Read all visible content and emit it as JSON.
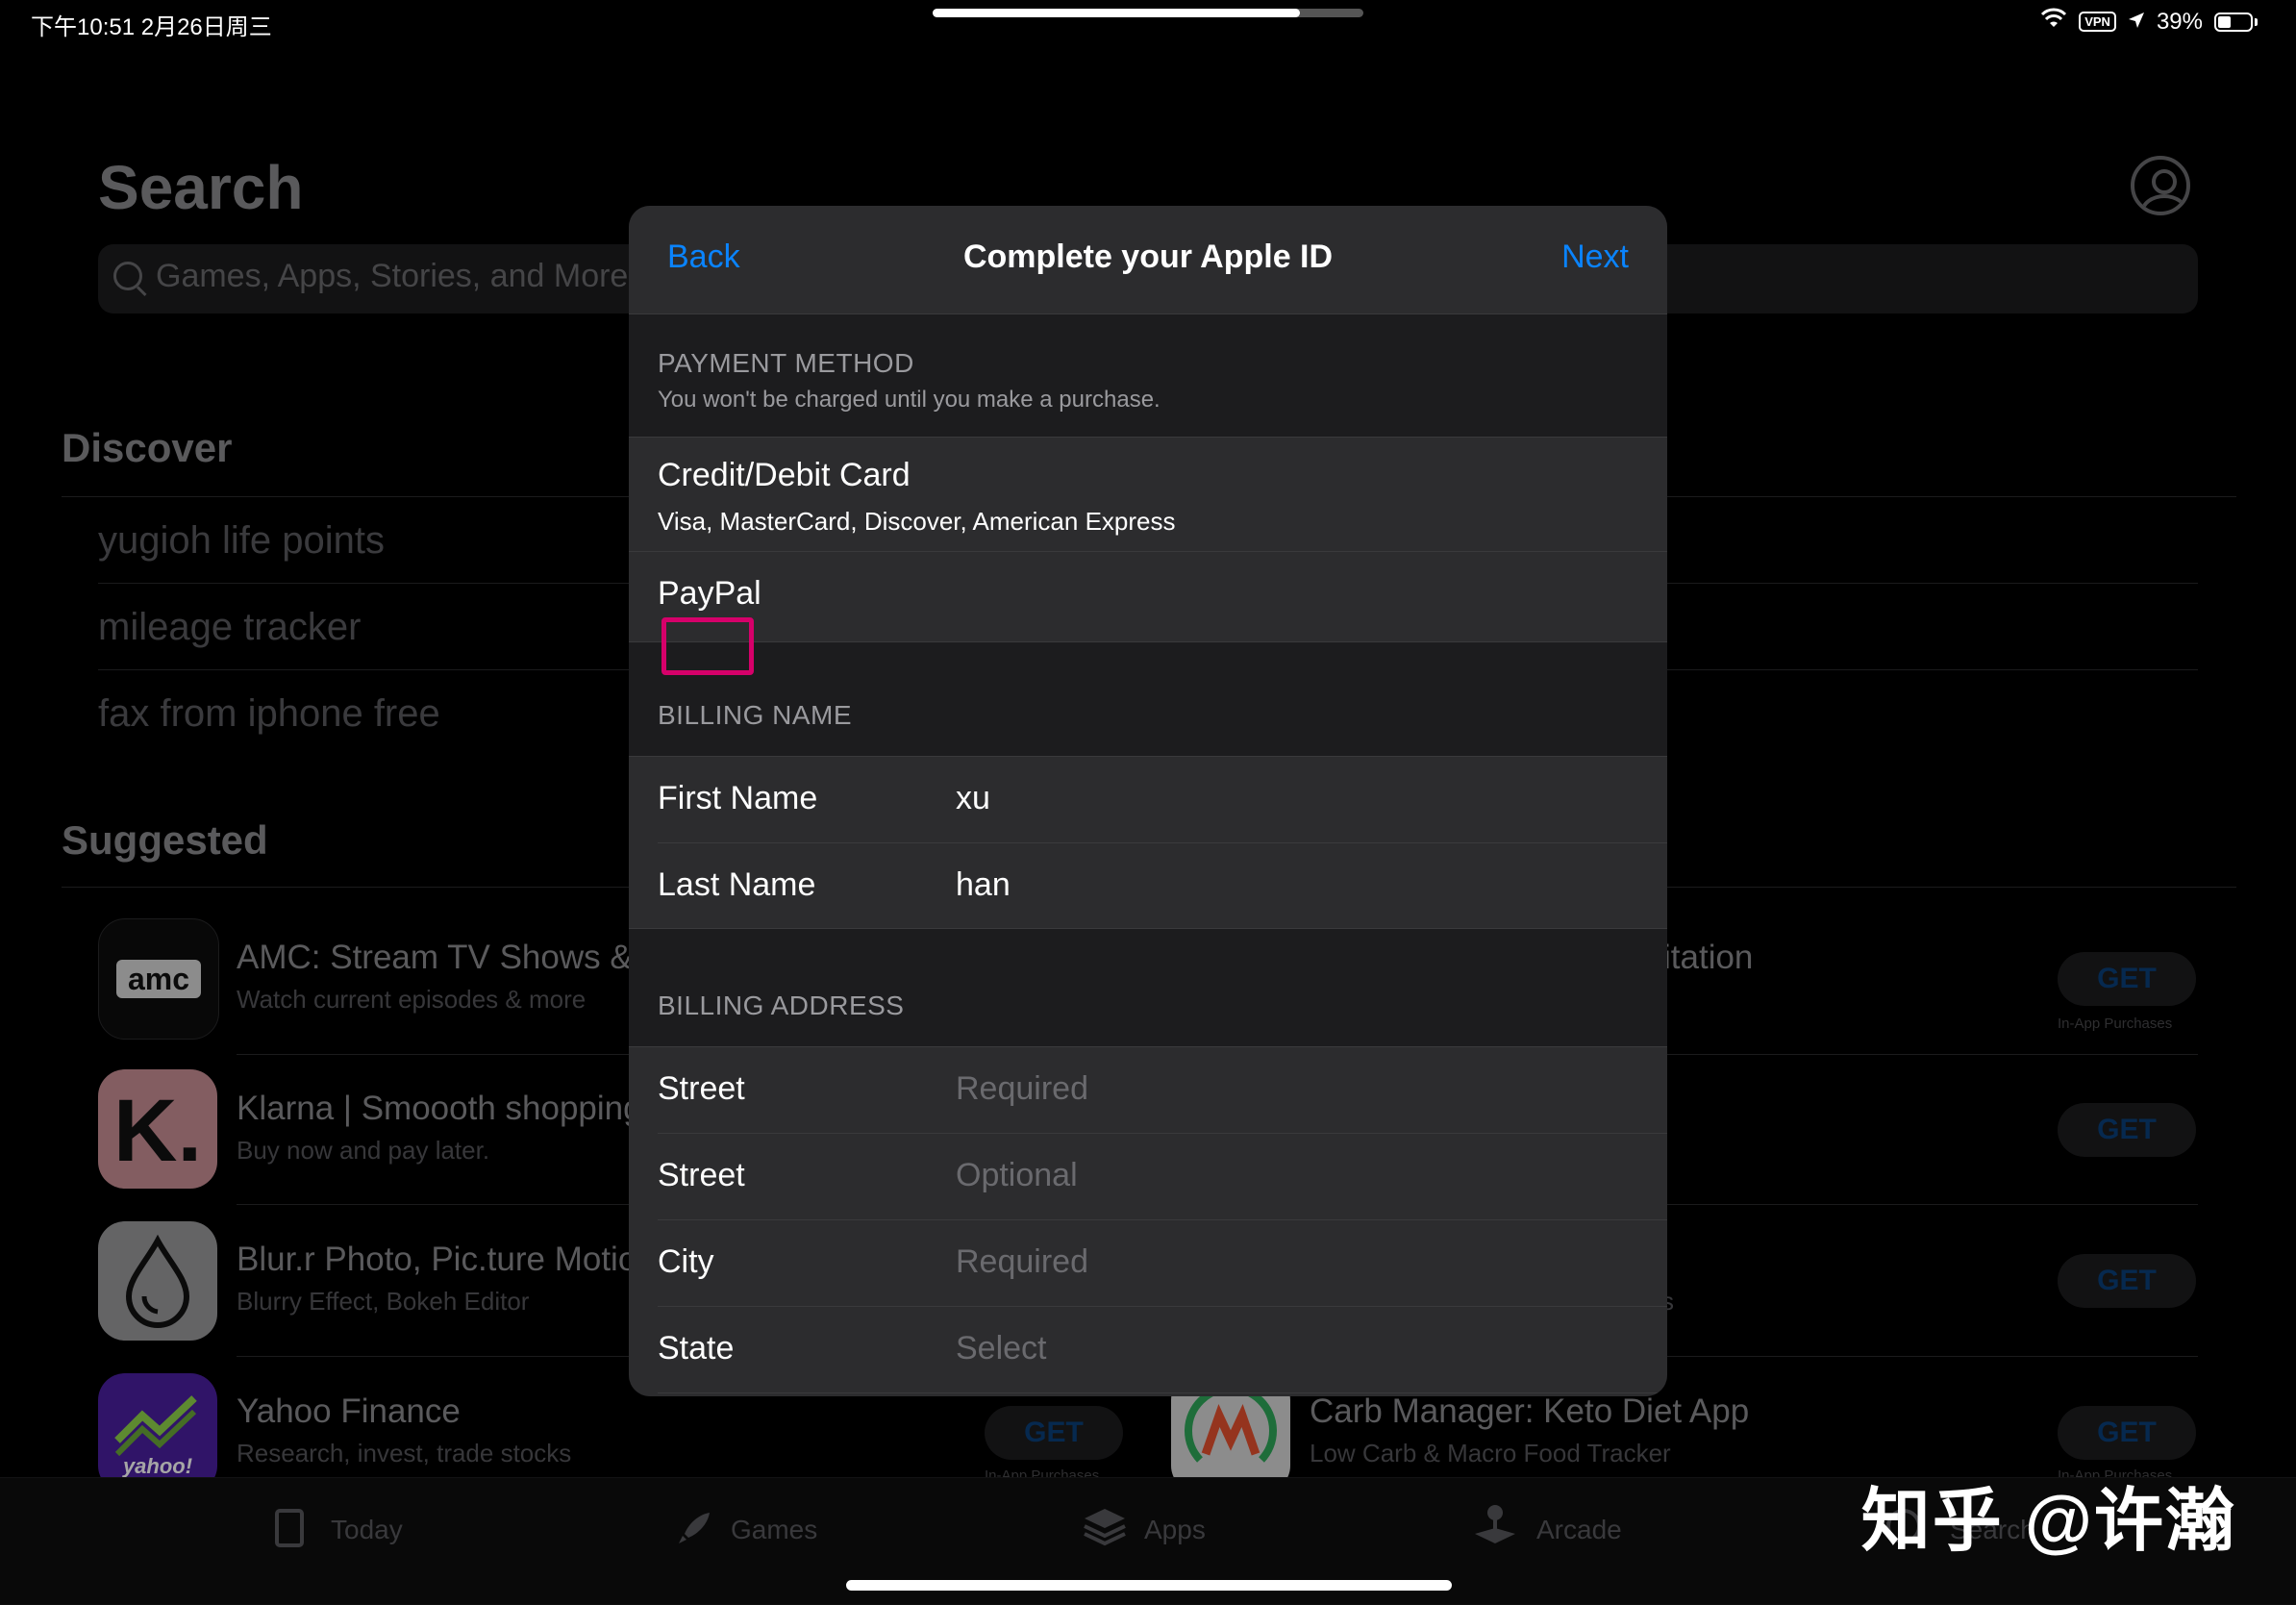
{
  "status_bar": {
    "time": "下午10:51   2月26日周三",
    "vpn": "VPN",
    "battery": "39%"
  },
  "background": {
    "search_title": "Search",
    "search_placeholder": "Games, Apps, Stories, and More",
    "discover": {
      "heading": "Discover",
      "items": [
        "yugioh life points",
        "mileage tracker",
        "fax from iphone free"
      ]
    },
    "suggested": {
      "heading": "Suggested",
      "apps": [
        {
          "title": "AMC: Stream TV Shows & M",
          "subtitle": "Watch current episodes & more"
        },
        {
          "title": "Klarna | Smoooth shopping",
          "subtitle": "Buy now and pay later."
        },
        {
          "title": "Blur.r Photo,  Pic.ture Motion",
          "subtitle": "Blurry Effect, Bokeh Editor"
        },
        {
          "title": "Yahoo Finance",
          "subtitle": "Research, invest, trade stocks"
        }
      ],
      "right_apps": [
        {
          "title": "Carb Manager: Keto Diet App",
          "subtitle": "Low Carb & Macro Food Tracker"
        }
      ],
      "partial_text": "itation",
      "partial_s": "s",
      "get_label": "GET",
      "in_app": "In-App Purchases",
      "amc_logo": "amc",
      "klarna_logo": "K.",
      "yahoo_logo": "yahoo!"
    },
    "tabs": [
      "Today",
      "Games",
      "Apps",
      "Arcade",
      "Search"
    ]
  },
  "watermark": "知乎 @许瀚",
  "modal": {
    "back": "Back",
    "title": "Complete your Apple ID",
    "next": "Next",
    "payment": {
      "label": "PAYMENT METHOD",
      "desc": "You won't be charged until you make a purchase.",
      "options": [
        {
          "title": "Credit/Debit Card",
          "subtitle": "Visa, MasterCard, Discover, American Express"
        },
        {
          "title": "PayPal"
        }
      ]
    },
    "billing_name": {
      "label": "BILLING NAME",
      "rows": [
        {
          "label": "First Name",
          "value": "xu"
        },
        {
          "label": "Last Name",
          "value": "han"
        }
      ]
    },
    "billing_address": {
      "label": "BILLING ADDRESS",
      "rows": [
        {
          "label": "Street",
          "placeholder": "Required"
        },
        {
          "label": "Street",
          "placeholder": "Optional"
        },
        {
          "label": "City",
          "placeholder": "Required"
        },
        {
          "label": "State",
          "placeholder": "Select"
        }
      ]
    }
  }
}
